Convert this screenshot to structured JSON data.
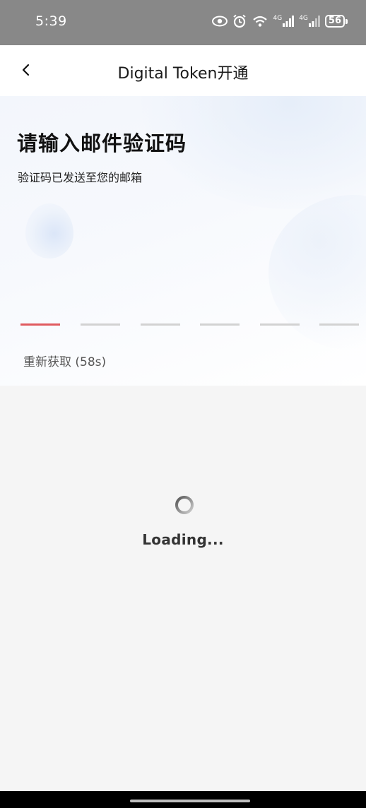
{
  "status_bar": {
    "time": "5:39",
    "icons": [
      "eye-icon",
      "alarm-icon",
      "wifi-icon",
      "signal-4g-icon",
      "signal-4g-icon"
    ],
    "network_labels": [
      "4G",
      "4G"
    ],
    "battery": "56"
  },
  "nav": {
    "title": "Digital Token开通",
    "back_icon": "chevron-left-icon"
  },
  "hero": {
    "title": "请输入邮件验证码",
    "subtitle": "验证码已发送至您的邮箱"
  },
  "code_input": {
    "length": 6,
    "active_index": 0,
    "colors": {
      "active": "#e05a5f",
      "inactive": "#d2d2d2"
    }
  },
  "resend": {
    "label": "重新获取 (58s)"
  },
  "loading": {
    "text": "Loading...",
    "icon": "spinner-icon"
  }
}
